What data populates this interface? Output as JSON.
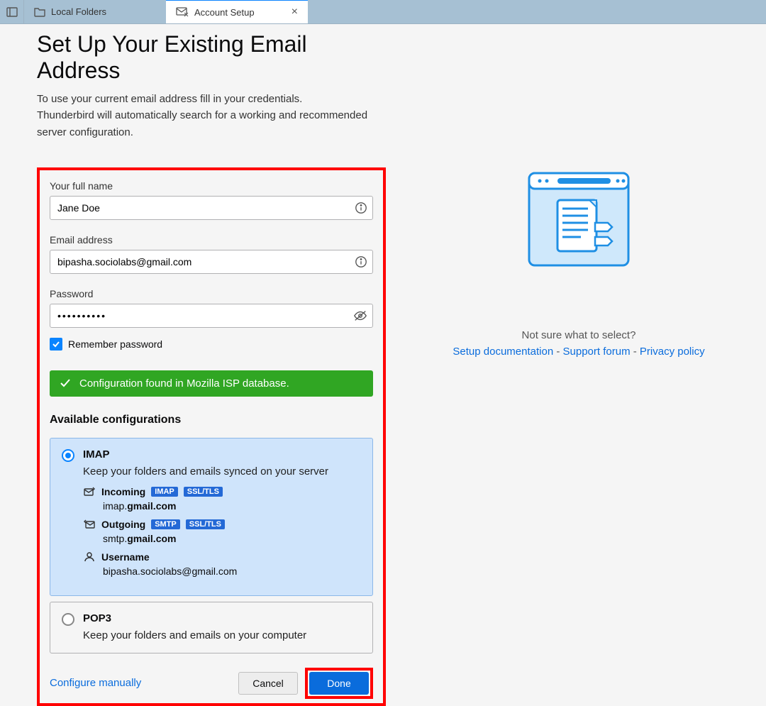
{
  "tabs": {
    "local": "Local Folders",
    "setup": "Account Setup"
  },
  "heading": "Set Up Your Existing Email Address",
  "sub1": "To use your current email address fill in your credentials.",
  "sub2": "Thunderbird will automatically search for a working and recommended server configuration.",
  "form": {
    "name_label": "Your full name",
    "name_value": "Jane Doe",
    "email_label": "Email address",
    "email_value": "bipasha.sociolabs@gmail.com",
    "password_label": "Password",
    "password_dots": "••••••••••",
    "remember": "Remember password"
  },
  "status": "Configuration found in Mozilla ISP database.",
  "config_heading": "Available configurations",
  "imap": {
    "title": "IMAP",
    "desc": "Keep your folders and emails synced on your server",
    "incoming_label": "Incoming",
    "incoming_badge1": "IMAP",
    "incoming_badge2": "SSL/TLS",
    "incoming_host_pre": "imap.",
    "incoming_host_bold": "gmail.com",
    "outgoing_label": "Outgoing",
    "outgoing_badge1": "SMTP",
    "outgoing_badge2": "SSL/TLS",
    "outgoing_host_pre": "smtp.",
    "outgoing_host_bold": "gmail.com",
    "user_label": "Username",
    "user_value": "bipasha.sociolabs@gmail.com"
  },
  "pop3": {
    "title": "POP3",
    "desc": "Keep your folders and emails on your computer"
  },
  "actions": {
    "manual": "Configure manually",
    "cancel": "Cancel",
    "done": "Done"
  },
  "help": {
    "prompt": "Not sure what to select?",
    "doc": "Setup documentation",
    "forum": "Support forum",
    "privacy": "Privacy policy",
    "sep": " - "
  }
}
